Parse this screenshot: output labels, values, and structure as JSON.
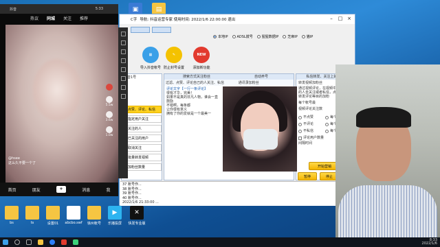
{
  "desktop": {
    "icons_top": [
      {
        "label": "",
        "color": "#3a7bd5",
        "glyph": "▣"
      },
      {
        "label": "",
        "color": "#f5c542",
        "glyph": "▤"
      }
    ],
    "icons_bottom": [
      {
        "label": "bs",
        "color": "#f5c542"
      },
      {
        "label": "ts",
        "color": "#f5c542"
      },
      {
        "label": "设置01",
        "color": "#f5c542"
      },
      {
        "label": "abcbo.swf",
        "color": "#ffffff"
      },
      {
        "label": "徐州帐号",
        "color": "#f5c542"
      },
      {
        "label": "乐播投屏",
        "color": "#2db4f0"
      },
      {
        "label": "快发专业版",
        "color": "#111111"
      }
    ],
    "tray_time": "8:33",
    "tray_date": "2022/1/6"
  },
  "app": {
    "title_prefix": "C字",
    "title_main": "导航: 抖音运营专家   使用时间: 2022/1/6 22:00:00   退出",
    "proxy_label": "局域网",
    "radio_options": [
      "本地IP",
      "ADSL拨号",
      "猩猩数据IP",
      "芝麻IP",
      "猫IP"
    ],
    "btn_import": "导入抖音帐号",
    "btn_settings": "防止封号设置",
    "btn_new": "添加新功能",
    "left_header": "抖音1号",
    "left_buttons": [
      "点赞、评论、私信",
      "指定用户关注",
      "关注的人",
      "已关注的用户",
      "取消关注",
      "批量转发视频",
      "加粉丝数量"
    ],
    "mid_header1": "搜索方式关注粉丝",
    "mid_header2": "自动养号",
    "mid_header3": "私信转发、关注上的粉丝",
    "mid_sub": "过滤、点赞、评论自己的人关注、私信",
    "mid_sub2": "通讯录加粉丝",
    "mid_sub3": "转发视频加粉丝",
    "mid_text": [
      "评论文字【一行一条评论】",
      "很有才华，完美！",
      "如果不是真的非凡人物，谁会一直鼓励",
      "不错啊，每条都",
      "让你很有意义",
      "拥有了你的爱就是一个最美一"
    ],
    "right_text": [
      "通过视频评论，在视频中",
      "的人去关注或者私信，点赞",
      "转发评论等目的加粉"
    ],
    "right_field1": "每个帐号最",
    "right_field2": "视频评论关注数",
    "right_opts": [
      "不点赞",
      "每个点赞",
      "不评论",
      "每个评论",
      "不私信",
      "每个私信"
    ],
    "right_check": "评论用户数量",
    "right_interval": "间隔时间",
    "right_val1": "19",
    "right_val2": "1",
    "btn_start": "开始营销",
    "btn_pause": "暂停",
    "btn_stop": "停止",
    "log_lines": [
      "37 账号作...",
      "38 账号作...",
      "39 账号作...",
      "40 账号作...",
      "2022/1/6 21:33:00 ..."
    ]
  },
  "phone": {
    "title": "抖音",
    "status_time": "5:33",
    "tabs": [
      "热议",
      "同城",
      "关注",
      "推荐"
    ],
    "active_tab": "同城",
    "overlay_author": "@hsee",
    "overlay_caption": "这么久不要一个了",
    "side_counts": [
      "5.5w",
      "3.6w",
      "1.0w"
    ],
    "bottom_nav": [
      "首页",
      "朋友",
      "消息",
      "我"
    ],
    "plus": "+"
  }
}
